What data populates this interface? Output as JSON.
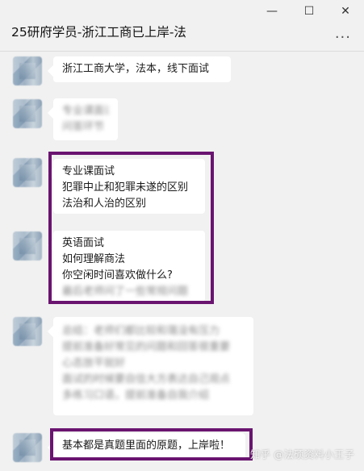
{
  "window": {
    "title": "25研府学员-浙江工商已上岸-法",
    "minimize_glyph": "—",
    "maximize_glyph": "☐",
    "close_glyph": "✕",
    "more_glyph": "···"
  },
  "messages": [
    {
      "text": "浙江工商大学，法本，线下面试"
    },
    {
      "lines": [
        "专业课面试",
        "问答环节"
      ]
    },
    {
      "lines": [
        "专业课面试",
        "犯罪中止和犯罪未遂的区别",
        "法治和人治的区别"
      ]
    },
    {
      "lines": [
        "英语面试",
        "如何理解商法",
        "你空闲时间喜欢做什么?",
        "最后老师问了一些常规问题"
      ]
    },
    {
      "lines": [
        "总结：老师们都比较和蔼没有压力",
        "提前准备好常见的问题和回答很重要",
        "心态放平就好",
        "面试的时候要自信大方表达自己观点",
        "多练习口语，提前准备自我介绍",
        "最后祝大家都能上岸成功"
      ]
    },
    {
      "text": "基本都是真题里面的原题，上岸啦！"
    }
  ],
  "watermark": "知乎 @法硕资料小王子"
}
